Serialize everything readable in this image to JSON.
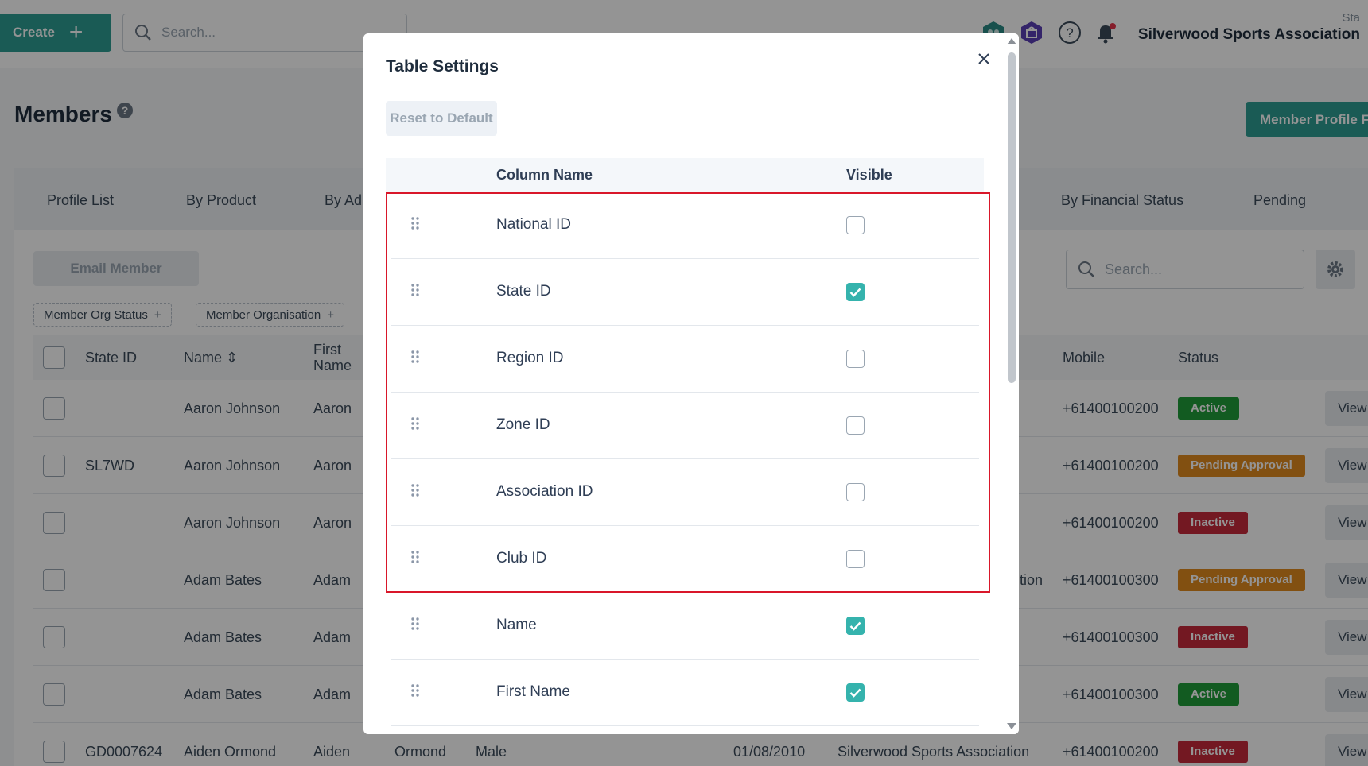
{
  "header": {
    "create_label": "Create",
    "search_placeholder": "Search...",
    "org_small": "Sta",
    "org_name": "Silverwood Sports Association"
  },
  "page": {
    "title": "Members",
    "help": "?",
    "member_profile_label": "Member Profile F"
  },
  "tabs": [
    "Profile List",
    "By Product",
    "By Ad",
    "By Financial Status",
    "Pending"
  ],
  "toolbar": {
    "email_label": "Email Member",
    "search_placeholder": "Search...",
    "filters": [
      {
        "label": "Member Org Status",
        "icon": "+"
      },
      {
        "label": "Member Organisation",
        "icon": "+"
      }
    ]
  },
  "table": {
    "headers": {
      "state_id": "State ID",
      "name": "Name",
      "first_name_1": "First",
      "first_name_2": "Name",
      "mobile": "Mobile",
      "status": "Status"
    },
    "view_label": "View",
    "rows": [
      {
        "state_id": "",
        "name": "Aaron Johnson",
        "first": "Aaron",
        "extra": "",
        "mobile": "+61400100200",
        "status": "Active"
      },
      {
        "state_id": "SL7WD",
        "name": "Aaron Johnson",
        "first": "Aaron",
        "extra": "",
        "mobile": "+61400100200",
        "status": "Pending Approval"
      },
      {
        "state_id": "",
        "name": "Aaron Johnson",
        "first": "Aaron",
        "extra": "",
        "mobile": "+61400100200",
        "status": "Inactive"
      },
      {
        "state_id": "",
        "name": "Adam Bates",
        "first": "Adam",
        "extra": "tion",
        "mobile": "+61400100300",
        "status": "Pending Approval"
      },
      {
        "state_id": "",
        "name": "Adam Bates",
        "first": "Adam",
        "extra": "",
        "mobile": "+61400100300",
        "status": "Inactive"
      },
      {
        "state_id": "",
        "name": "Adam Bates",
        "first": "Adam",
        "extra": "",
        "mobile": "+61400100300",
        "status": "Active"
      },
      {
        "state_id": "GD0007624",
        "name": "Aiden Ormond",
        "first": "Aiden",
        "surname": "Ormond",
        "gender": "Male",
        "dob": "01/08/2010",
        "org": "Silverwood Sports Association",
        "mobile": "+61400100200",
        "status": "Inactive"
      }
    ],
    "status_colors": {
      "Active": "#1f9d3a",
      "Pending Approval": "#e08a1e",
      "Inactive": "#c62a3c"
    }
  },
  "modal": {
    "title": "Table Settings",
    "reset_label": "Reset to Default",
    "col_name_header": "Column Name",
    "visible_header": "Visible",
    "rows": [
      {
        "label": "National ID",
        "visible": false
      },
      {
        "label": "State ID",
        "visible": true
      },
      {
        "label": "Region ID",
        "visible": false
      },
      {
        "label": "Zone ID",
        "visible": false
      },
      {
        "label": "Association ID",
        "visible": false
      },
      {
        "label": "Club ID",
        "visible": false
      },
      {
        "label": "Name",
        "visible": true
      },
      {
        "label": "First Name",
        "visible": true
      }
    ],
    "accent_color": "#35b3ad",
    "highlight_color": "#d9172a"
  }
}
